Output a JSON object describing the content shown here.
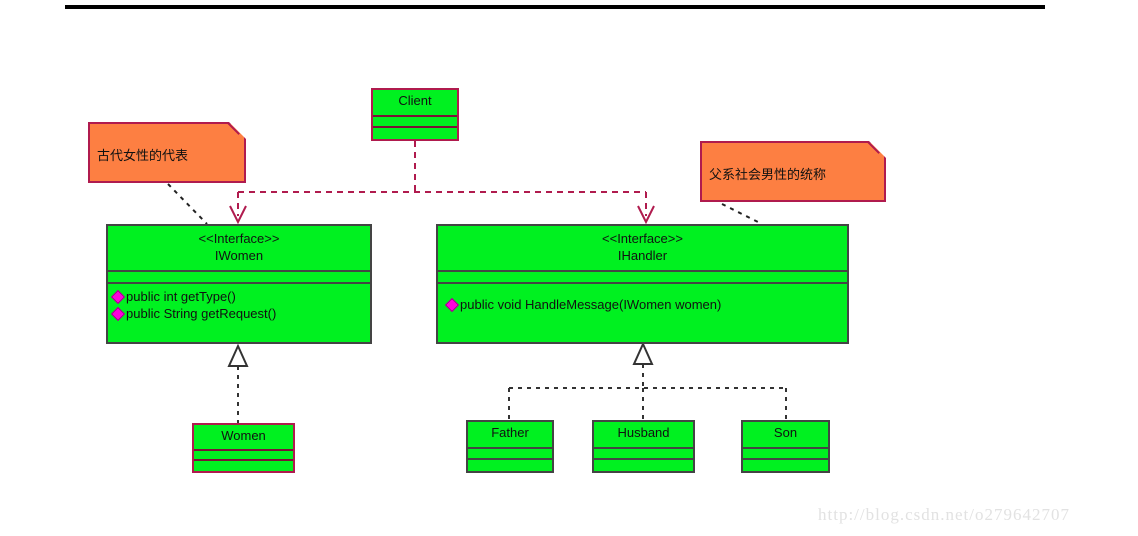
{
  "diagram": {
    "title": "Chain of Responsibility UML class diagram",
    "background": "#ffffff",
    "colors": {
      "class_fill": "#00f120",
      "class_border": "#444444",
      "class_border_accent": "#b01b4e",
      "note_fill": "#fd7f42",
      "note_border": "#b01b4e",
      "dependency_line": "#b01b4e",
      "generalization_line": "#333333",
      "visibility_marker": "#ff00dd",
      "rule": "#000000",
      "watermark": "#e2e2e2"
    }
  },
  "classes": {
    "client": {
      "name": "Client",
      "compartments": [
        "",
        ""
      ]
    },
    "iwomen": {
      "stereotype": "<<Interface>>",
      "name": "IWomen",
      "methods": [
        "public int getType()",
        "public String getRequest()"
      ]
    },
    "ihandler": {
      "stereotype": "<<Interface>>",
      "name": "IHandler",
      "methods": [
        "public void HandleMessage(IWomen women)"
      ]
    },
    "women": {
      "name": "Women"
    },
    "father": {
      "name": "Father"
    },
    "husband": {
      "name": "Husband"
    },
    "son": {
      "name": "Son"
    }
  },
  "notes": {
    "left": {
      "text": "古代女性的代表"
    },
    "right": {
      "text": "父系社会男性的统称"
    }
  },
  "relations": [
    {
      "kind": "dependency",
      "from": "Client",
      "to": "IWomen"
    },
    {
      "kind": "dependency",
      "from": "Client",
      "to": "IHandler"
    },
    {
      "kind": "generalization",
      "from": "Women",
      "to": "IWomen"
    },
    {
      "kind": "generalization",
      "from": "Father",
      "to": "IHandler"
    },
    {
      "kind": "generalization",
      "from": "Husband",
      "to": "IHandler"
    },
    {
      "kind": "generalization",
      "from": "Son",
      "to": "IHandler"
    },
    {
      "kind": "note-anchor",
      "from": "左注释",
      "to": "IWomen"
    },
    {
      "kind": "note-anchor",
      "from": "右注释",
      "to": "IHandler"
    }
  ],
  "watermark": {
    "text": "http://blog.csdn.net/o279642707"
  }
}
